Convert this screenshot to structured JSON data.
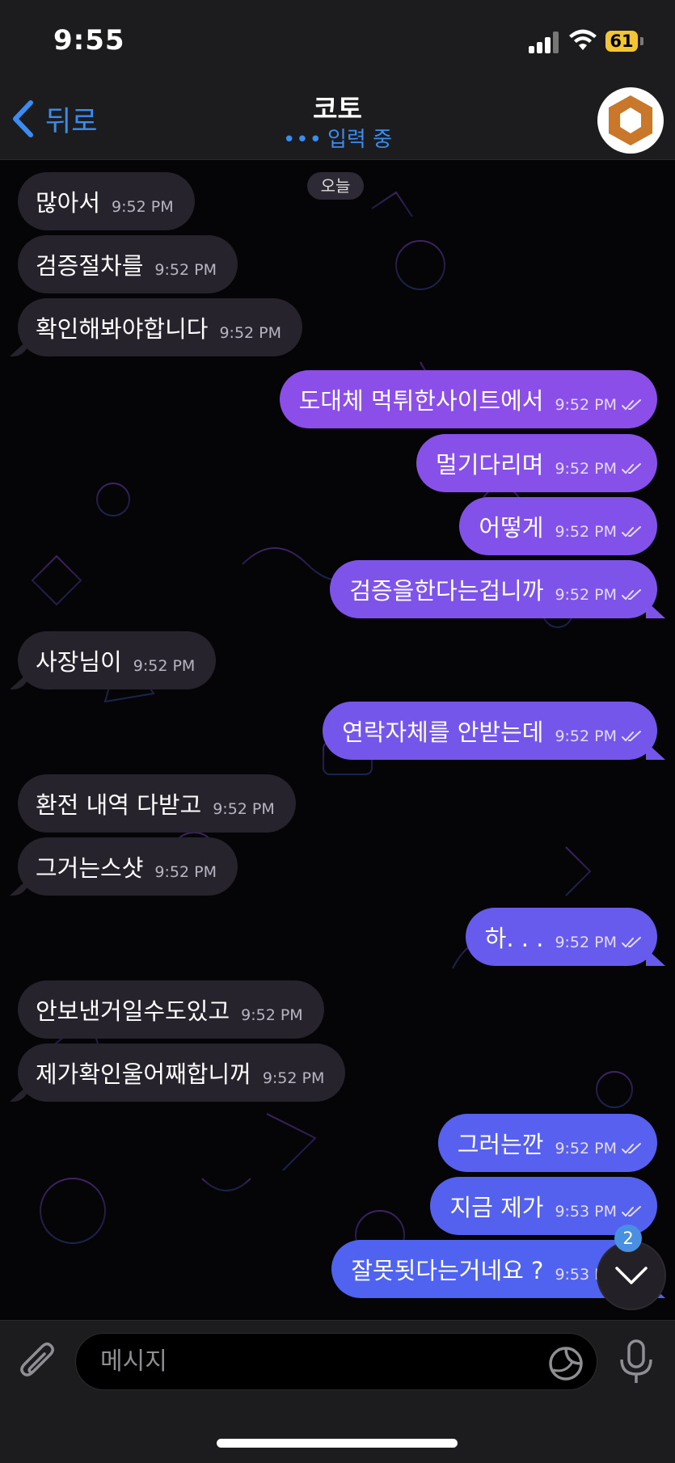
{
  "status": {
    "time": "9:55",
    "battery": "61"
  },
  "nav": {
    "back_label": "뒤로",
    "title": "코토",
    "typing": "입력 중",
    "typing_dots": "•••"
  },
  "chat": {
    "date_chip": "오늘",
    "messages": [
      {
        "side": "in",
        "text": "많아서",
        "time": "9:52 PM"
      },
      {
        "side": "in",
        "text": "검증절차를",
        "time": "9:52 PM"
      },
      {
        "side": "in",
        "text": "확인해봐야합니다",
        "time": "9:52 PM"
      },
      {
        "side": "out",
        "text": "도대체 먹튀한사이트에서",
        "time": "9:52 PM",
        "read": true
      },
      {
        "side": "out",
        "text": "멀기다리며",
        "time": "9:52 PM",
        "read": true
      },
      {
        "side": "out",
        "text": "어떻게",
        "time": "9:52 PM",
        "read": true
      },
      {
        "side": "out",
        "text": "검증을한다는겁니까",
        "time": "9:52 PM",
        "read": true
      },
      {
        "side": "in",
        "text": "사장님이",
        "time": "9:52 PM"
      },
      {
        "side": "out",
        "text": "연락자체를 안받는데",
        "time": "9:52 PM",
        "read": true
      },
      {
        "side": "in",
        "text": "환전 내역 다받고",
        "time": "9:52 PM"
      },
      {
        "side": "in",
        "text": "그거는스샷",
        "time": "9:52 PM"
      },
      {
        "side": "out",
        "text": "하. . .",
        "time": "9:52 PM",
        "read": true
      },
      {
        "side": "in",
        "text": "안보낸거일수도있고",
        "time": "9:52 PM"
      },
      {
        "side": "in",
        "text": "제가확인울어째합니꺼",
        "time": "9:52 PM"
      },
      {
        "side": "out",
        "text": "그러는깐",
        "time": "9:52 PM",
        "read": true
      },
      {
        "side": "out",
        "text": "지금 제가",
        "time": "9:53 PM",
        "read": true
      },
      {
        "side": "out",
        "text": "잘못됫다는거네요 ?",
        "time": "9:53 PM",
        "read": true
      }
    ],
    "unread_count": "2"
  },
  "input": {
    "placeholder": "메시지"
  },
  "colors": {
    "accent": "#3b8cf0",
    "incoming_bubble": "#27232d",
    "outgoing_top": "#8b4ee8",
    "outgoing_bottom": "#4f63f0",
    "avatar_ring": "#c9772a"
  },
  "icons": [
    "back-chevron-icon",
    "hexagon-logo-icon",
    "paperclip-icon",
    "sticker-icon",
    "microphone-icon",
    "chevron-down-icon",
    "double-check-icon"
  ]
}
